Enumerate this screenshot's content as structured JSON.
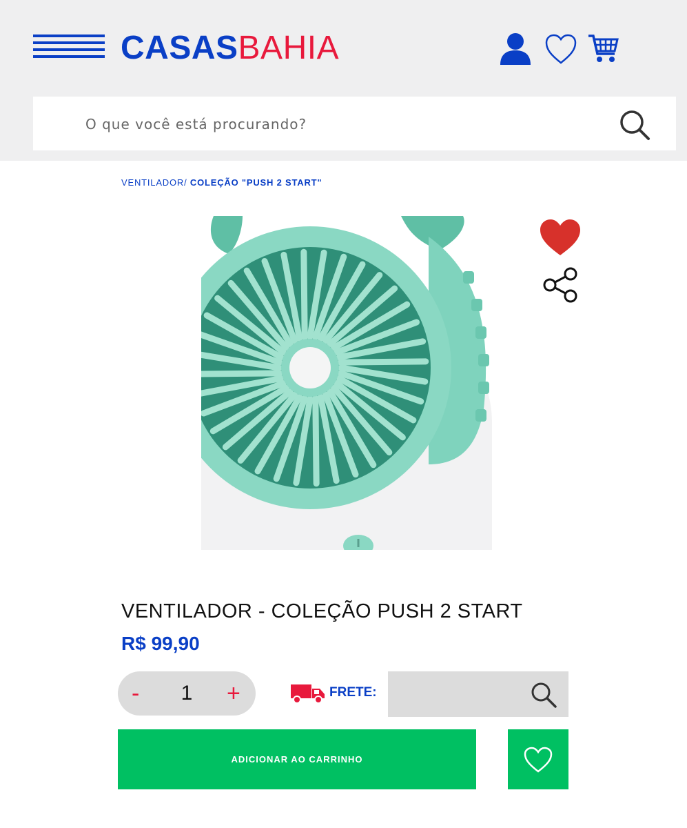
{
  "header": {
    "logo_part1": "CASAS",
    "logo_part2": "BAHIA",
    "search_placeholder": "O que você está procurando?"
  },
  "breadcrumb": {
    "parent": "VENTILADOR/",
    "current": "COLEÇÃO \"PUSH 2 START\""
  },
  "product": {
    "title": "VENTILADOR - COLEÇÃO PUSH 2 START",
    "price": "R$ 99,90"
  },
  "quantity": {
    "minus": "-",
    "value": "1",
    "plus": "+"
  },
  "shipping": {
    "label": "FRETE:"
  },
  "actions": {
    "add_to_cart": "ADICIONAR AO CARRINHO"
  },
  "colors": {
    "brand_blue": "#0a3fc6",
    "brand_red": "#e8193c",
    "cta_green": "#00c062"
  }
}
